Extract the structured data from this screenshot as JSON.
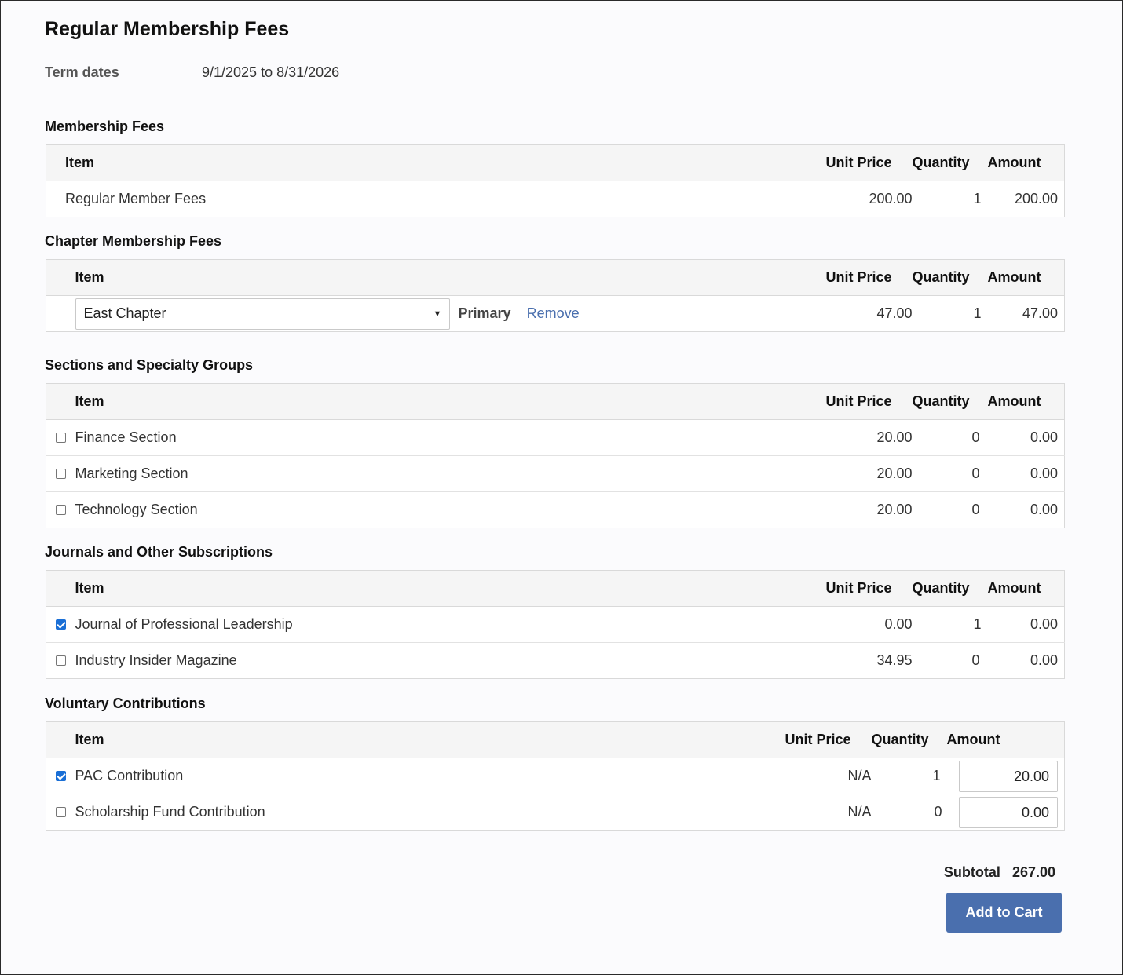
{
  "title": "Regular Membership Fees",
  "term": {
    "label": "Term dates",
    "value": "9/1/2025 to 8/31/2026"
  },
  "headers": {
    "item": "Item",
    "unit_price": "Unit Price",
    "quantity": "Quantity",
    "amount": "Amount"
  },
  "membership": {
    "title": "Membership Fees",
    "rows": [
      {
        "item": "Regular Member Fees",
        "unit_price": "200.00",
        "quantity": "1",
        "amount": "200.00"
      }
    ]
  },
  "chapter": {
    "title": "Chapter Membership Fees",
    "selected": "East Chapter",
    "primary": "Primary",
    "remove": "Remove",
    "unit_price": "47.00",
    "quantity": "1",
    "amount": "47.00"
  },
  "sections": {
    "title": "Sections and Specialty Groups",
    "rows": [
      {
        "checked": false,
        "item": "Finance Section",
        "unit_price": "20.00",
        "quantity": "0",
        "amount": "0.00"
      },
      {
        "checked": false,
        "item": "Marketing Section",
        "unit_price": "20.00",
        "quantity": "0",
        "amount": "0.00"
      },
      {
        "checked": false,
        "item": "Technology Section",
        "unit_price": "20.00",
        "quantity": "0",
        "amount": "0.00"
      }
    ]
  },
  "journals": {
    "title": "Journals and Other Subscriptions",
    "rows": [
      {
        "checked": true,
        "item": "Journal of Professional Leadership",
        "unit_price": "0.00",
        "quantity": "1",
        "amount": "0.00"
      },
      {
        "checked": false,
        "item": "Industry Insider Magazine",
        "unit_price": "34.95",
        "quantity": "0",
        "amount": "0.00"
      }
    ]
  },
  "contributions": {
    "title": "Voluntary Contributions",
    "rows": [
      {
        "checked": true,
        "item": "PAC Contribution",
        "unit_price": "N/A",
        "quantity": "1",
        "amount": "20.00"
      },
      {
        "checked": false,
        "item": "Scholarship Fund Contribution",
        "unit_price": "N/A",
        "quantity": "0",
        "amount": "0.00"
      }
    ]
  },
  "subtotal": {
    "label": "Subtotal",
    "value": "267.00"
  },
  "add_to_cart": "Add to Cart",
  "colors": {
    "accent": "#4a6fae",
    "checkbox": "#1a6fd6",
    "header_bg": "#f5f5f5"
  }
}
